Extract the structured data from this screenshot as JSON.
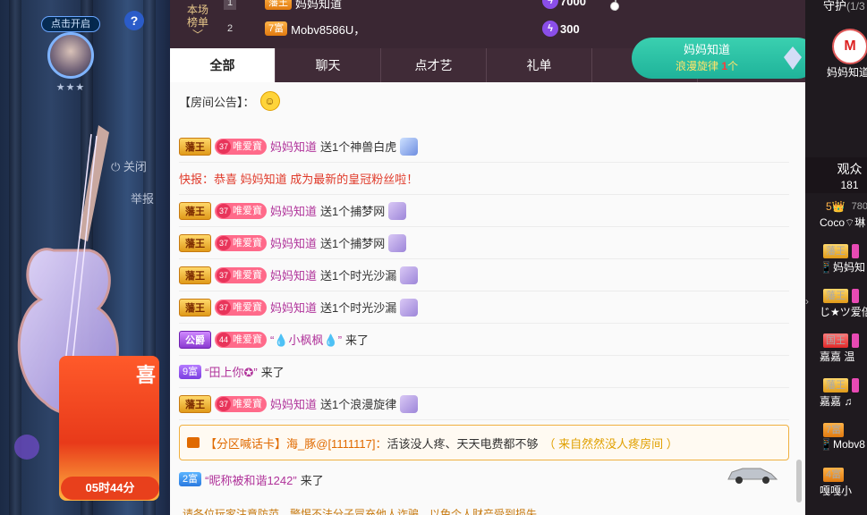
{
  "left": {
    "badge": "点击开启",
    "stars": "★★★",
    "help": "?",
    "close_label": "关闭",
    "report_label": "举报",
    "gift_tag": "喜",
    "timer": "05时44分"
  },
  "ranking": {
    "label": "本场榜单",
    "rows": [
      {
        "rank": "1",
        "level": "藩王",
        "name": "妈妈知道",
        "score": "7000"
      },
      {
        "rank": "2",
        "level": "7富",
        "name": "Mobv8586U，",
        "score": "300"
      }
    ]
  },
  "song_bubble": {
    "name": "妈妈知道",
    "line2_prefix": "浪漫旋律 ",
    "count": "1",
    "line2_suffix": "个"
  },
  "tabs": [
    "全部",
    "聊天",
    "点才艺",
    "礼单",
    ""
  ],
  "announcement": {
    "label": "【房间公告】："
  },
  "messages": [
    {
      "badge": "藩王",
      "fan_level": "37",
      "fan_label": "唯爱寶",
      "user": "妈妈知道",
      "text": "送1个神兽白虎"
    },
    {
      "type": "flash",
      "text": "快报：恭喜 妈妈知道 成为最新的皇冠粉丝啦！"
    },
    {
      "badge": "藩王",
      "fan_level": "37",
      "fan_label": "唯爱寶",
      "user": "妈妈知道",
      "text": "送1个捕梦网"
    },
    {
      "badge": "藩王",
      "fan_level": "37",
      "fan_label": "唯爱寶",
      "user": "妈妈知道",
      "text": "送1个捕梦网"
    },
    {
      "badge": "藩王",
      "fan_level": "37",
      "fan_label": "唯爱寶",
      "user": "妈妈知道",
      "text": "送1个时光沙漏"
    },
    {
      "badge": "藩王",
      "fan_level": "37",
      "fan_label": "唯爱寶",
      "user": "妈妈知道",
      "text": "送1个时光沙漏"
    },
    {
      "badge": "公爵",
      "fan_level": "44",
      "fan_label": "唯爱寶",
      "user": "“💧小枫枫💧”",
      "text": "来了"
    },
    {
      "badge": "9富",
      "user": "“田上你✪”",
      "text": "来了"
    },
    {
      "badge": "藩王",
      "fan_level": "37",
      "fan_label": "唯爱寶",
      "user": "妈妈知道",
      "text": "送1个浪漫旋律"
    }
  ],
  "zone_card": {
    "label": "【分区喊话卡】",
    "user": "海_豚@[1111117]：",
    "msg": "活该没人疼、天天电费都不够",
    "source": "（ 来自然然没人疼房间 ）"
  },
  "last_message": {
    "badge": "2富",
    "user": "“昵称被和谐1242”",
    "text": "来了"
  },
  "bottom_note": "请各位玩家注意防范，警惕不法分子冒充他人诈骗，以免个人财产受到损失",
  "right": {
    "guard_title": "守护",
    "guard_count": "(1/3",
    "guard_avatar": "M",
    "guard_name": "妈妈知道",
    "audience_title": "观众",
    "audience_count": "181",
    "expand": "›",
    "users": [
      {
        "tag": "5👑",
        "extra": "780",
        "name": "Coco⌔琳"
      },
      {
        "tag": "藩王",
        "extra": "",
        "name": "📱妈妈知"
      },
      {
        "tag": "藩王",
        "extra": "",
        "name": "じ★ツ爱倍"
      },
      {
        "tag": "国王",
        "extra": "",
        "name": "嘉嘉 温"
      },
      {
        "tag": "藩王",
        "extra": "",
        "name": "嘉嘉 ♫"
      },
      {
        "tag": "7富",
        "extra": "",
        "name": "📱Mobv8"
      },
      {
        "tag": "4富",
        "extra": "",
        "name": "嘎嘎小"
      }
    ]
  },
  "colors": {
    "accent_green": "#1fb39a",
    "user_name": "#b0339a",
    "flash": "#e03a2a",
    "tab_bar": "#402b37"
  }
}
